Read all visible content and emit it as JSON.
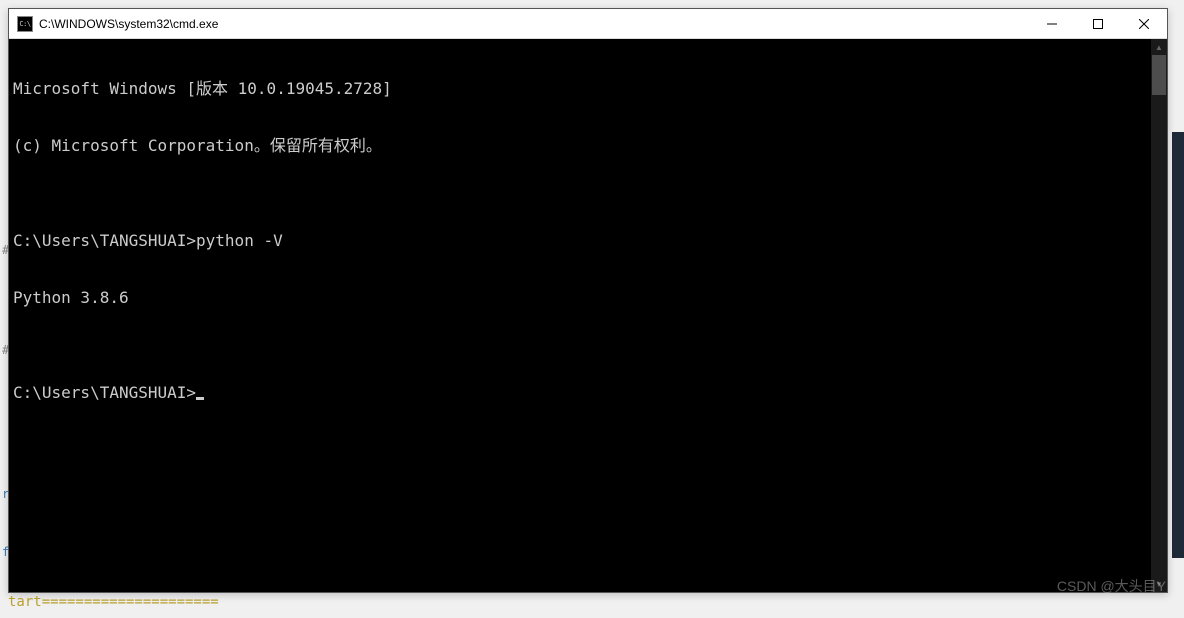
{
  "window": {
    "icon_label": "C:\\",
    "title": "C:\\WINDOWS\\system32\\cmd.exe"
  },
  "terminal": {
    "lines": [
      "Microsoft Windows [版本 10.0.19045.2728]",
      "(c) Microsoft Corporation。保留所有权利。",
      "",
      "C:\\Users\\TANGSHUAI>python -V",
      "Python 3.8.6",
      "",
      "C:\\Users\\TANGSHUAI>"
    ]
  },
  "watermark": "CSDN @大头目Y",
  "bg": {
    "bottom_text": "tart====================="
  }
}
